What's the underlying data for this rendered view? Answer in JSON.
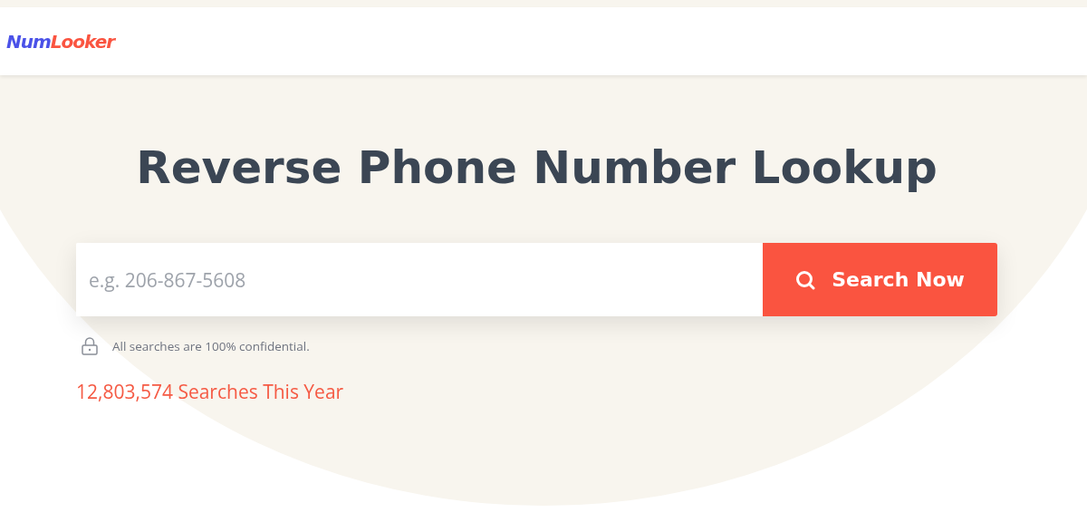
{
  "header": {
    "logo": [
      "Num",
      "Looker"
    ]
  },
  "hero": {
    "title": "Reverse Phone Number Lookup",
    "search": {
      "placeholder": "e.g. 206-867-5608",
      "button": "Search Now"
    },
    "privacy_note": "All searches are 100% confidential.",
    "counter": "12,803,574 Searches This Year"
  }
}
